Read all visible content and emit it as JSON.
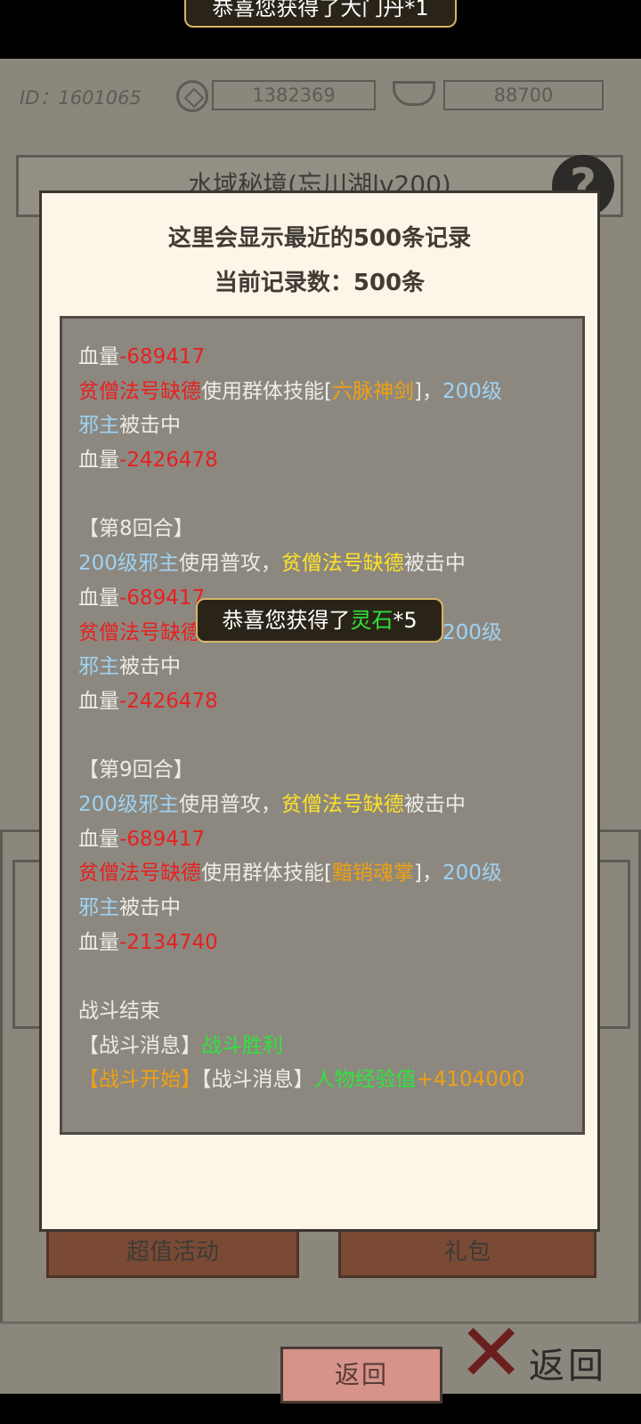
{
  "top_toast": {
    "text": "恭喜您获得了大门丹*1"
  },
  "background": {
    "id_text": "ID：1601065",
    "currency_1": "1382369",
    "currency_2": "88700",
    "title": "水域秘境(忘川湖lv200)",
    "help_icon": "?",
    "bottom_left_button": "超值活动",
    "bottom_right_button": "礼包",
    "back_label": "返回",
    "back_icon": "cross-icon"
  },
  "modal": {
    "title": "这里会显示最近的500条记录",
    "count": "当前记录数：500条",
    "return_label": "返回"
  },
  "log": [
    [
      {
        "t": "血量",
        "c": "white"
      },
      {
        "t": "-689417",
        "c": "red"
      }
    ],
    [
      {
        "t": "贫僧法号缺德",
        "c": "red"
      },
      {
        "t": "使用群体技能[",
        "c": "white"
      },
      {
        "t": "六脉神剑",
        "c": "orange"
      },
      {
        "t": "]，",
        "c": "white"
      },
      {
        "t": "200级",
        "c": "blue"
      }
    ],
    [
      {
        "t": "邪主",
        "c": "blue"
      },
      {
        "t": "被击中",
        "c": "white"
      }
    ],
    [
      {
        "t": "血量",
        "c": "white"
      },
      {
        "t": "-2426478",
        "c": "red"
      }
    ],
    [],
    [
      {
        "t": "【第8回合】",
        "c": "white"
      }
    ],
    [
      {
        "t": "200级邪主",
        "c": "blue"
      },
      {
        "t": "使用普攻，",
        "c": "white"
      },
      {
        "t": "贫僧法号缺德",
        "c": "yellow"
      },
      {
        "t": "被击中",
        "c": "white"
      }
    ],
    [
      {
        "t": "血量",
        "c": "white"
      },
      {
        "t": "-689417",
        "c": "red"
      }
    ],
    [
      {
        "t": "贫僧法号缺德",
        "c": "red"
      },
      {
        "t": "使用群体技能[",
        "c": "white"
      },
      {
        "t": "六脉神剑",
        "c": "orange"
      },
      {
        "t": "]，",
        "c": "white"
      },
      {
        "t": "200级",
        "c": "blue"
      }
    ],
    [
      {
        "t": "邪主",
        "c": "blue"
      },
      {
        "t": "被击中",
        "c": "white"
      }
    ],
    [
      {
        "t": "血量",
        "c": "white"
      },
      {
        "t": "-2426478",
        "c": "red"
      }
    ],
    [],
    [
      {
        "t": "【第9回合】",
        "c": "white"
      }
    ],
    [
      {
        "t": "200级邪主",
        "c": "blue"
      },
      {
        "t": "使用普攻，",
        "c": "white"
      },
      {
        "t": "贫僧法号缺德",
        "c": "yellow"
      },
      {
        "t": "被击中",
        "c": "white"
      }
    ],
    [
      {
        "t": "血量",
        "c": "white"
      },
      {
        "t": "-689417",
        "c": "red"
      }
    ],
    [
      {
        "t": "贫僧法号缺德",
        "c": "red"
      },
      {
        "t": "使用群体技能[",
        "c": "white"
      },
      {
        "t": "黯销魂掌",
        "c": "orange"
      },
      {
        "t": "]，",
        "c": "white"
      },
      {
        "t": "200级",
        "c": "blue"
      }
    ],
    [
      {
        "t": "邪主",
        "c": "blue"
      },
      {
        "t": "被击中",
        "c": "white"
      }
    ],
    [
      {
        "t": "血量",
        "c": "white"
      },
      {
        "t": "-2134740",
        "c": "red"
      }
    ],
    [],
    [
      {
        "t": "战斗结束",
        "c": "white"
      }
    ],
    [
      {
        "t": "【战斗消息】",
        "c": "white"
      },
      {
        "t": "战斗胜利",
        "c": "green"
      }
    ],
    [
      {
        "t": "【战斗开始】",
        "c": "orange"
      },
      {
        "t": "【战斗消息】",
        "c": "white"
      },
      {
        "t": "人物经验值",
        "c": "green"
      },
      {
        "t": "+4104000",
        "c": "orange"
      }
    ]
  ],
  "center_toast": {
    "prefix": "恭喜您获得了",
    "item": "灵石",
    "suffix": "*5"
  },
  "colors": {
    "red": "#e8201f",
    "orange": "#f0a011",
    "blue": "#9fd2f2",
    "yellow": "#ffe227",
    "green": "#2fe43a",
    "white": "#ecece6",
    "modal_bg": "#fdf5e7",
    "log_bg": "#8c8880",
    "return_button": "#d5938a"
  }
}
